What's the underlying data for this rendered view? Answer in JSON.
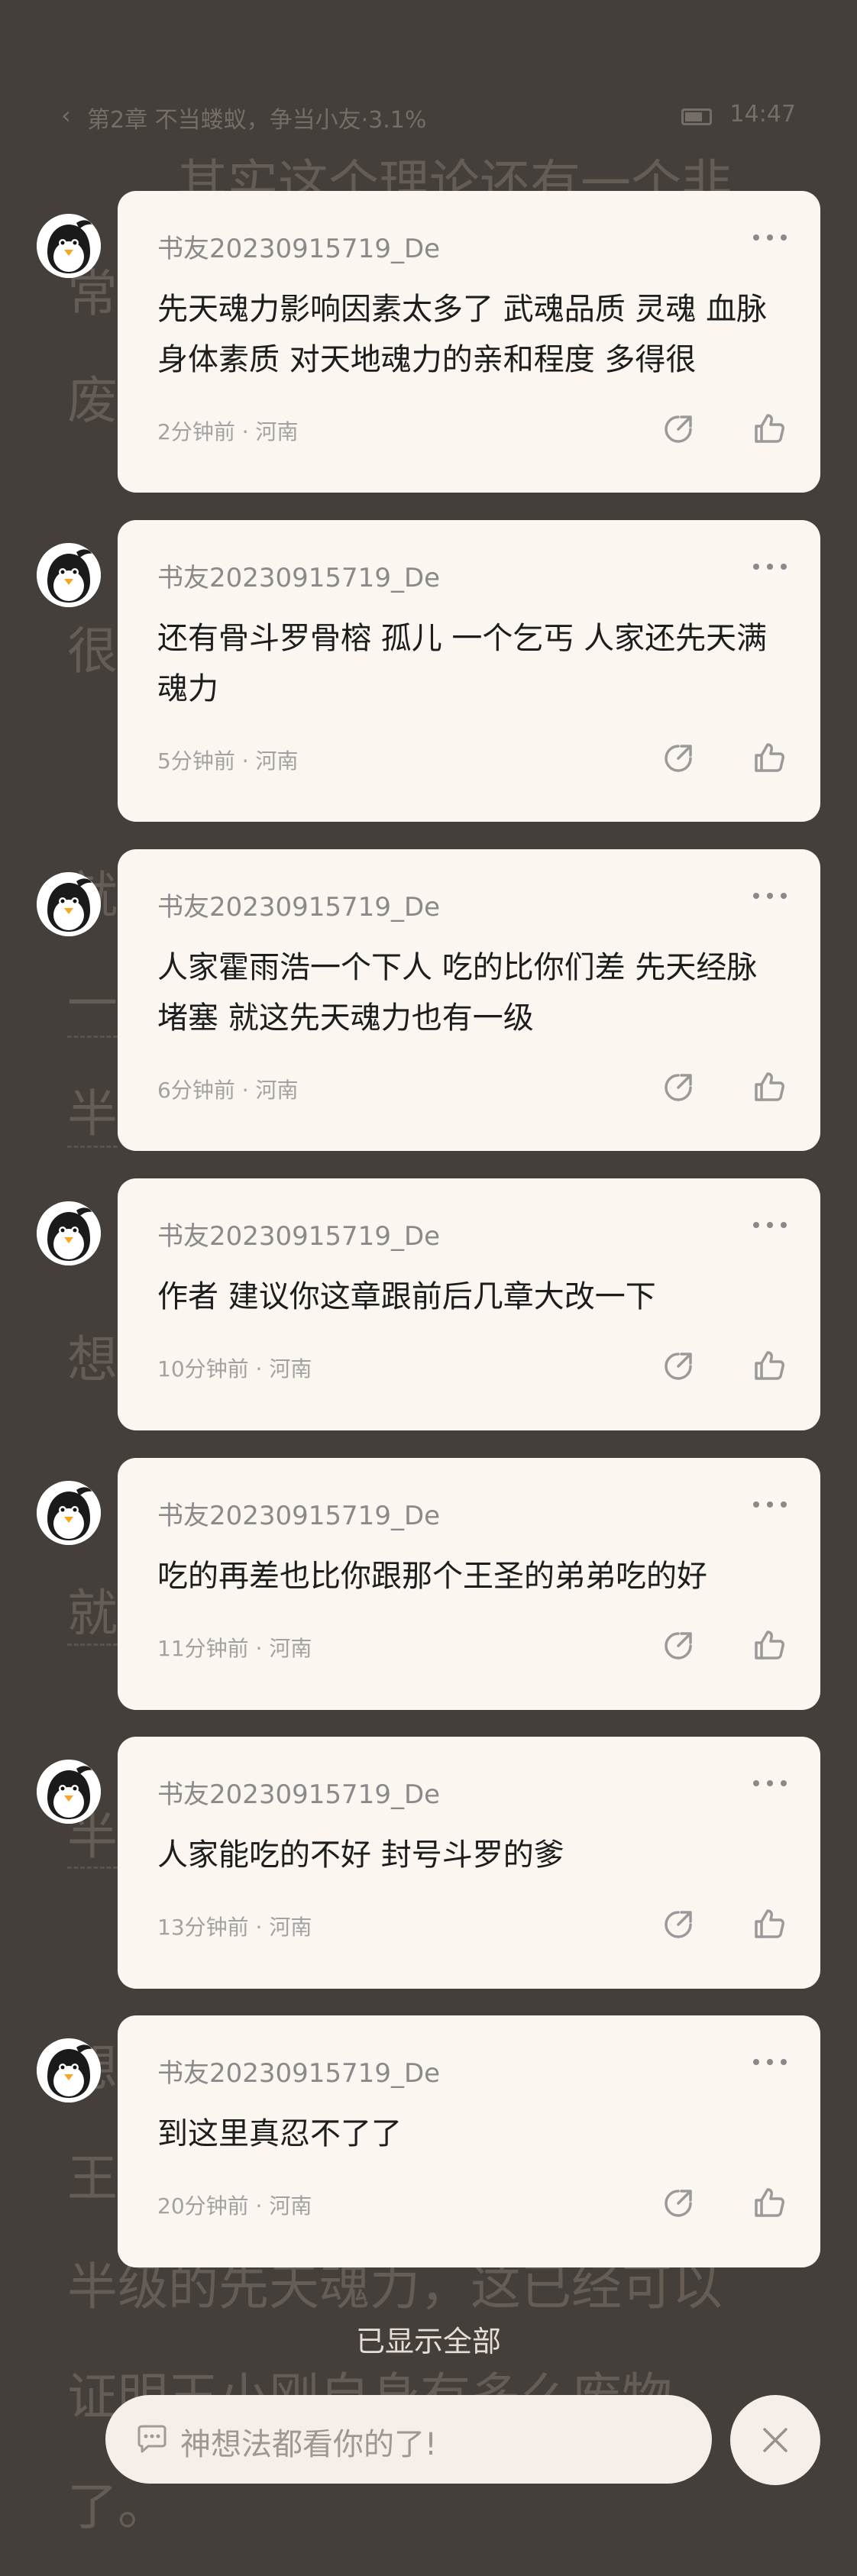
{
  "status_bar": {
    "chapter": "第2章 不当蝼蚁，争当小友·3.1%",
    "time": "14:47"
  },
  "comments": [
    {
      "username": "书友20230915719_De",
      "text": "先天魂力影响因素太多了 武魂品质 灵魂 血脉 身体素质 对天地魂力的亲和程度 多得很",
      "time": "2分钟前",
      "location": "河南"
    },
    {
      "username": "书友20230915719_De",
      "text": "还有骨斗罗骨榕 孤儿 一个乞丐 人家还先天满魂力",
      "time": "5分钟前",
      "location": "河南"
    },
    {
      "username": "书友20230915719_De",
      "text": "人家霍雨浩一个下人 吃的比你们差 先天经脉堵塞 就这先天魂力也有一级",
      "time": "6分钟前",
      "location": "河南"
    },
    {
      "username": "书友20230915719_De",
      "text": "作者 建议你这章跟前后几章大改一下",
      "time": "10分钟前",
      "location": "河南"
    },
    {
      "username": "书友20230915719_De",
      "text": "吃的再差也比你跟那个王圣的弟弟吃的好",
      "time": "11分钟前",
      "location": "河南"
    },
    {
      "username": "书友20230915719_De",
      "text": "人家能吃的不好 封号斗罗的爹",
      "time": "13分钟前",
      "location": "河南"
    },
    {
      "username": "书友20230915719_De",
      "text": "到这里真忍不了了",
      "time": "20分钟前",
      "location": "河南"
    }
  ],
  "meta_separator": "·",
  "footer": {
    "shown_all": "已显示全部",
    "input_placeholder": "神想法都看你的了!"
  },
  "colors": {
    "card_bg": "#fcf6f1",
    "overlay_bg": "#534d47"
  }
}
